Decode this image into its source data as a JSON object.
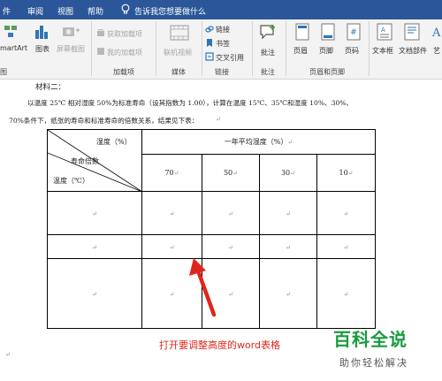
{
  "menu": {
    "file": "件",
    "review": "审阅",
    "view": "视图",
    "help": "帮助",
    "tell_me": "告诉我您想要做什么"
  },
  "ribbon": {
    "smartart": "martArt",
    "chart": "图表",
    "screenshot": "屏幕截图",
    "get_addins": "获取加载项",
    "my_addins": "我的加载项",
    "online_video": "联机视频",
    "link": "链接",
    "bookmark": "书签",
    "crossref": "交叉引用",
    "comment": "批注",
    "header": "页眉",
    "footer": "页脚",
    "page_number": "页码",
    "textbox": "文本框",
    "doc_parts": "文档部件",
    "wordart": "艺",
    "groups": {
      "illustrations": "图",
      "addins": "加载项",
      "media": "媒体",
      "links": "链接",
      "comments": "批注",
      "header_footer": "页眉和页脚"
    }
  },
  "document": {
    "heading": "材料二：",
    "para_line1": "以温度 25℃ 相对湿度 50%为标准寿命（设其指数为 1.00），计算在温度 15℃、35℃和湿度 10%、30%、",
    "para_line2": "70%条件下，纸张的寿命和标准寿命的倍数关系，结果见下表：",
    "paragraph_mark": "↵",
    "table": {
      "diag_humidity": "湿度（%）",
      "diag_multiple": "寿命倍数",
      "diag_temp": "温度（℃）",
      "header_avg": "一年平均湿度（%）",
      "humidity_values": [
        "70",
        "50",
        "30",
        "10"
      ]
    }
  },
  "annotation": {
    "caption": "打开要调整高度的word表格",
    "arrow_color": "#e0261b"
  },
  "watermark": {
    "brand": "百科全说",
    "slogan": "助你轻松解决"
  },
  "colors": {
    "title_bar": "#2b579a",
    "ribbon_bg": "#f3f3f3",
    "accent_red": "#e0261b",
    "brand_green": "#1a9b3e"
  }
}
